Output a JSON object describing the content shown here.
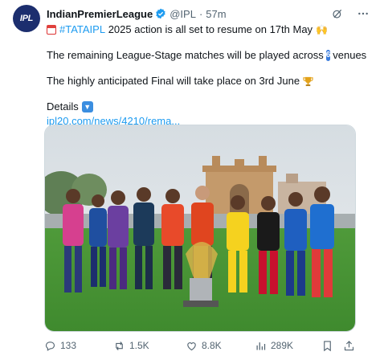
{
  "author": {
    "avatar_text": "IPL",
    "name": "IndianPremierLeague",
    "handle": "@IPL",
    "separator": "·",
    "time": "57m"
  },
  "tweet": {
    "line1_hashtag": "#TATAIPL",
    "line1_text": " 2025 action is all set to resume on 17th May",
    "line1_emoji": "🙌",
    "line2_prefix": "The remaining League-Stage matches will be played across",
    "line2_number": "6",
    "line2_suffix": "venues",
    "line3_text": "The highly anticipated Final will take place on 3rd June",
    "line4_text": "Details",
    "line5_link": "ipl20.com/news/4210/rema..."
  },
  "actions": {
    "replies": "133",
    "reposts": "1.5K",
    "likes": "8.8K",
    "views": "289K"
  },
  "colors": {
    "link": "#1d9bf0",
    "secondary_text": "#536471",
    "avatar_bg": "#1c2e6e",
    "verified": "#1d9bf0"
  },
  "icons": [
    "grok-icon",
    "more-icon",
    "reply-icon",
    "repost-icon",
    "like-icon",
    "views-icon",
    "bookmark-icon",
    "share-icon"
  ]
}
